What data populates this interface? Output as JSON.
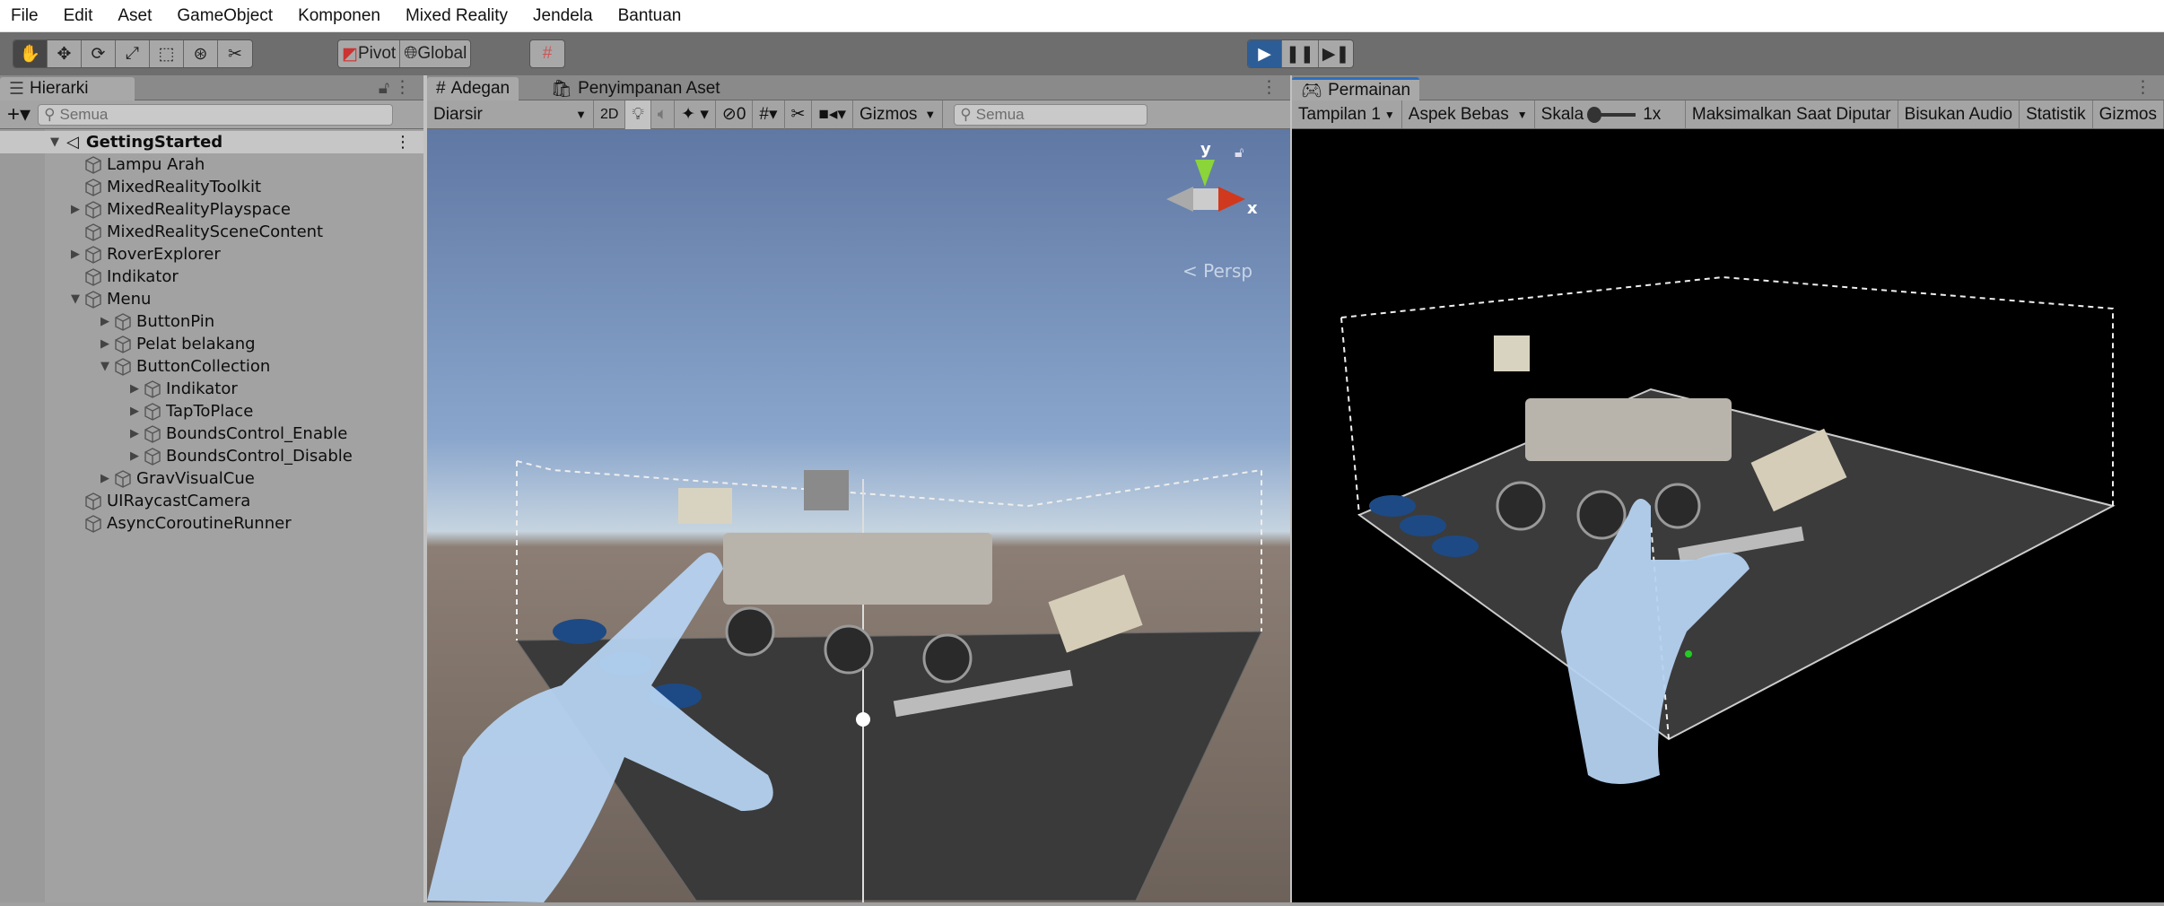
{
  "menu": [
    "File",
    "Edit",
    "Aset",
    "GameObject",
    "Komponen",
    "Mixed Reality",
    "Jendela",
    "Bantuan"
  ],
  "toolbar": {
    "pivot": "Pivot",
    "global": "Global"
  },
  "hierarchy": {
    "tab": "Hierarki",
    "search_placeholder": "Semua",
    "scene": "GettingStarted",
    "items": [
      {
        "label": "Lampu Arah",
        "depth": 1,
        "arrow": ""
      },
      {
        "label": "MixedRealityToolkit",
        "depth": 1,
        "arrow": ""
      },
      {
        "label": "MixedRealityPlayspace",
        "depth": 1,
        "arrow": "▶"
      },
      {
        "label": "MixedRealitySceneContent",
        "depth": 1,
        "arrow": ""
      },
      {
        "label": "RoverExplorer",
        "depth": 1,
        "arrow": "▶"
      },
      {
        "label": "Indikator",
        "depth": 1,
        "arrow": ""
      },
      {
        "label": "Menu",
        "depth": 1,
        "arrow": "▼"
      },
      {
        "label": "ButtonPin",
        "depth": 2,
        "arrow": "▶"
      },
      {
        "label": "Pelat belakang",
        "depth": 2,
        "arrow": "▶"
      },
      {
        "label": "ButtonCollection",
        "depth": 2,
        "arrow": "▼"
      },
      {
        "label": "Indikator",
        "depth": 3,
        "arrow": "▶"
      },
      {
        "label": "TapToPlace",
        "depth": 3,
        "arrow": "▶"
      },
      {
        "label": "BoundsControl_Enable",
        "depth": 3,
        "arrow": "▶"
      },
      {
        "label": "BoundsControl_Disable",
        "depth": 3,
        "arrow": "▶"
      },
      {
        "label": "GravVisualCue",
        "depth": 2,
        "arrow": "▶"
      },
      {
        "label": "UIRaycastCamera",
        "depth": 1,
        "arrow": ""
      },
      {
        "label": "AsyncCoroutineRunner",
        "depth": 1,
        "arrow": ""
      }
    ]
  },
  "scene": {
    "tab": "Adegan",
    "tab2": "Penyimpanan Aset",
    "shading": "Diarsir",
    "mode2d": "2D",
    "hidden_count": "0",
    "gizmos": "Gizmos",
    "search_placeholder": "Semua",
    "gizmo_y": "y",
    "gizmo_x": "x",
    "persp": "Persp"
  },
  "game": {
    "tab": "Permainan",
    "display": "Tampilan 1",
    "aspect": "Aspek Bebas",
    "scale_label": "Skala",
    "scale_value": "1x",
    "maximize": "Maksimalkan Saat Diputar",
    "mute": "Bisukan Audio",
    "stats": "Statistik",
    "gizmos": "Gizmos"
  },
  "colors": {
    "play_active": "#2d5d96",
    "sky": "#5f78a4",
    "ground": "#6d625a"
  }
}
